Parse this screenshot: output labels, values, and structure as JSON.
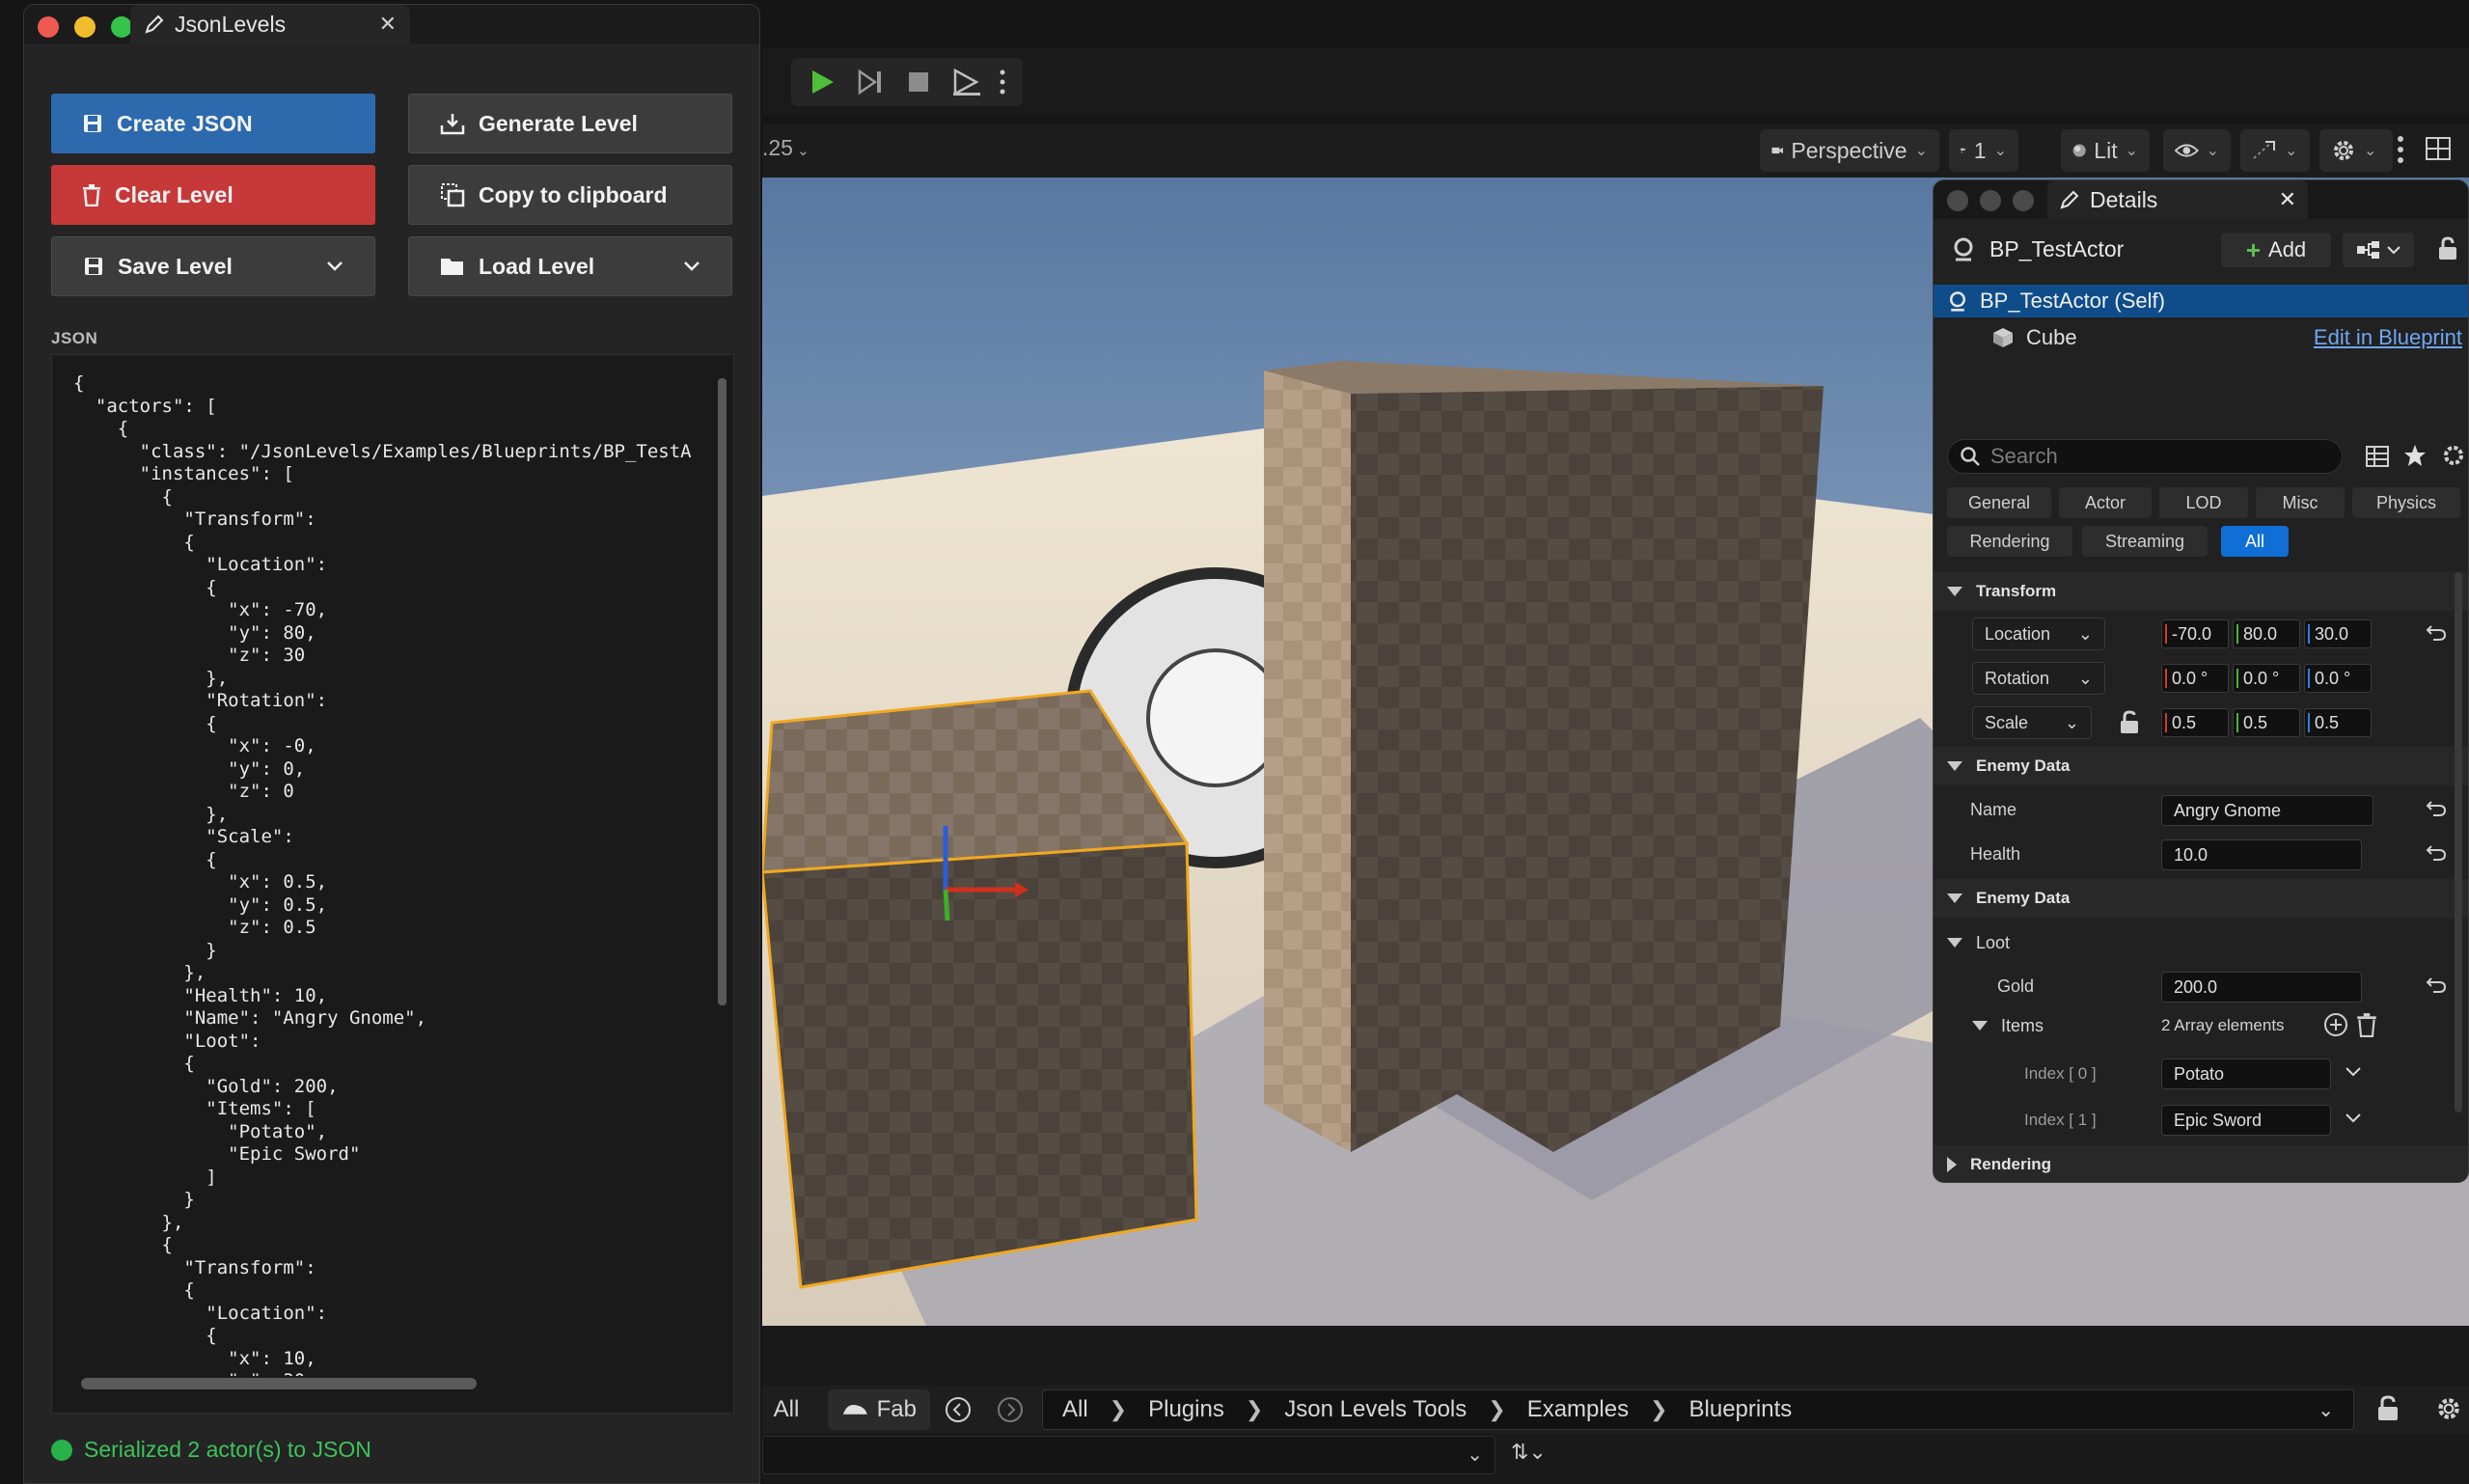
{
  "jsonlevels": {
    "tab_title": "JsonLevels",
    "buttons": {
      "create_json": "Create JSON",
      "generate_level": "Generate Level",
      "clear_level": "Clear Level",
      "copy_clipboard": "Copy to clipboard",
      "save_level": "Save Level",
      "load_level": "Load Level"
    },
    "json_label": "JSON",
    "json_text": "{\n  \"actors\": [\n    {\n      \"class\": \"/JsonLevels/Examples/Blueprints/BP_TestActor.BP_TestActor_C\",\n      \"instances\": [\n        {\n          \"Transform\":\n          {\n            \"Location\":\n            {\n              \"x\": -70,\n              \"y\": 80,\n              \"z\": 30\n            },\n            \"Rotation\":\n            {\n              \"x\": -0,\n              \"y\": 0,\n              \"z\": 0\n            },\n            \"Scale\":\n            {\n              \"x\": 0.5,\n              \"y\": 0.5,\n              \"z\": 0.5\n            }\n          },\n          \"Health\": 10,\n          \"Name\": \"Angry Gnome\",\n          \"Loot\":\n          {\n            \"Gold\": 200,\n            \"Items\": [\n              \"Potato\",\n              \"Epic Sword\"\n            ]\n          }\n        },\n        {\n          \"Transform\":\n          {\n            \"Location\":\n            {\n              \"x\": 10,\n              \"y\": 30,",
    "status": "Serialized 2 actor(s) to JSON"
  },
  "viewport": {
    "zoom_fragment": ".25",
    "perspective": "Perspective",
    "camera_speed": "1",
    "lit": "Lit"
  },
  "content_browser": {
    "all": "All",
    "fab": "Fab",
    "breadcrumbs": [
      "All",
      "Plugins",
      "Json Levels Tools",
      "Examples",
      "Blueprints"
    ]
  },
  "details": {
    "tab_title": "Details",
    "actor_name": "BP_TestActor",
    "add_label": "Add",
    "self_item": "BP_TestActor (Self)",
    "component": "Cube",
    "edit_blueprint": "Edit in Blueprint",
    "search_placeholder": "Search",
    "filters_row1": [
      "General",
      "Actor",
      "LOD",
      "Misc",
      "Physics"
    ],
    "filters_row2": [
      "Rendering",
      "Streaming",
      "All"
    ],
    "transform": {
      "title": "Transform",
      "location_label": "Location",
      "location": [
        "-70.0",
        "80.0",
        "30.0"
      ],
      "rotation_label": "Rotation",
      "rotation": [
        "0.0 °",
        "0.0 °",
        "0.0 °"
      ],
      "scale_label": "Scale",
      "scale": [
        "0.5",
        "0.5",
        "0.5"
      ]
    },
    "enemy_data": {
      "title": "Enemy Data",
      "name_label": "Name",
      "name_value": "Angry Gnome",
      "health_label": "Health",
      "health_value": "10.0"
    },
    "enemy_data2": {
      "title": "Enemy Data",
      "loot_title": "Loot",
      "gold_label": "Gold",
      "gold_value": "200.0",
      "items_label": "Items",
      "items_count": "2 Array elements",
      "index0_label": "Index [ 0 ]",
      "index0_value": "Potato",
      "index1_label": "Index [ 1 ]",
      "index1_value": "Epic Sword"
    },
    "rendering_title": "Rendering"
  }
}
